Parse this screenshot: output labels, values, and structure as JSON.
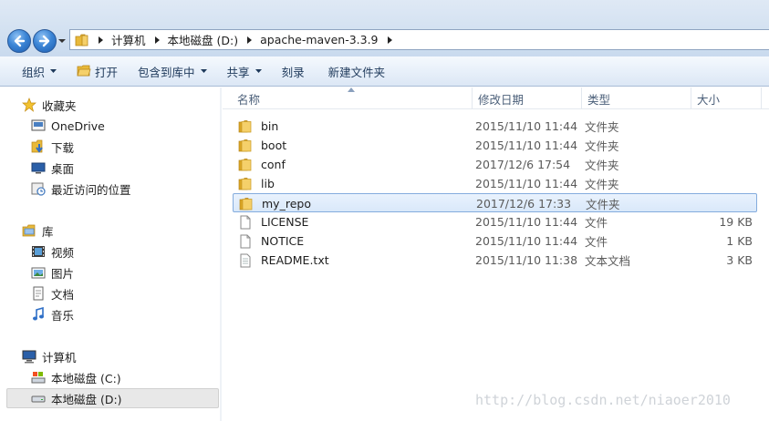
{
  "breadcrumb": {
    "items": [
      "计算机",
      "本地磁盘 (D:)",
      "apache-maven-3.3.9"
    ]
  },
  "toolbar": {
    "organize": "组织",
    "open": "打开",
    "include_in_library": "包含到库中",
    "share": "共享",
    "burn": "刻录",
    "new_folder": "新建文件夹"
  },
  "navpane": {
    "favorites": {
      "label": "收藏夹",
      "items": [
        "OneDrive",
        "下载",
        "桌面",
        "最近访问的位置"
      ]
    },
    "libraries": {
      "label": "库",
      "items": [
        "视频",
        "图片",
        "文档",
        "音乐"
      ]
    },
    "computer": {
      "label": "计算机",
      "items": [
        "本地磁盘 (C:)",
        "本地磁盘 (D:)"
      ]
    }
  },
  "columns": {
    "name": "名称",
    "date": "修改日期",
    "type": "类型",
    "size": "大小"
  },
  "files": [
    {
      "name": "bin",
      "date": "2015/11/10 11:44",
      "type": "文件夹",
      "size": "",
      "icon": "folder-icon"
    },
    {
      "name": "boot",
      "date": "2015/11/10 11:44",
      "type": "文件夹",
      "size": "",
      "icon": "folder-icon"
    },
    {
      "name": "conf",
      "date": "2017/12/6 17:54",
      "type": "文件夹",
      "size": "",
      "icon": "folder-icon"
    },
    {
      "name": "lib",
      "date": "2015/11/10 11:44",
      "type": "文件夹",
      "size": "",
      "icon": "folder-icon"
    },
    {
      "name": "my_repo",
      "date": "2017/12/6 17:33",
      "type": "文件夹",
      "size": "",
      "icon": "folder-icon",
      "selected": true
    },
    {
      "name": "LICENSE",
      "date": "2015/11/10 11:44",
      "type": "文件",
      "size": "19 KB",
      "icon": "file-icon"
    },
    {
      "name": "NOTICE",
      "date": "2015/11/10 11:44",
      "type": "文件",
      "size": "1 KB",
      "icon": "file-icon"
    },
    {
      "name": "README.txt",
      "date": "2015/11/10 11:38",
      "type": "文本文档",
      "size": "3 KB",
      "icon": "text-file-icon"
    }
  ],
  "watermark": "http://blog.csdn.net/niaoer2010",
  "colors": {
    "accent": "#3d86d6",
    "selection_border": "#84acdd",
    "folder": "#e8b93a"
  }
}
